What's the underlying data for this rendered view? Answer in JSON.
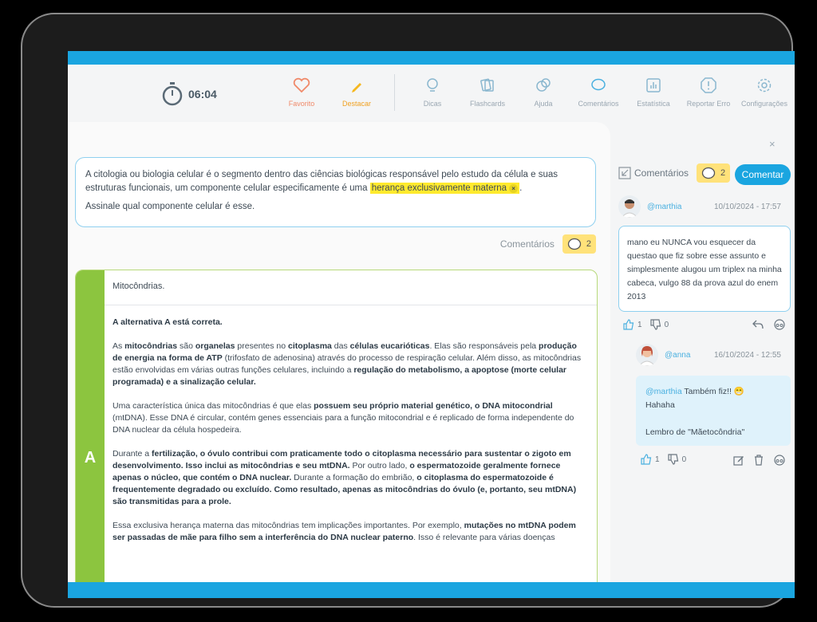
{
  "timer": {
    "value": "06:04"
  },
  "toolbar": {
    "favorite": "Favorito",
    "highlight": "Destacar",
    "tips": "Dicas",
    "flashcards": "Flashcards",
    "help": "Ajuda",
    "comments": "Comentários",
    "stats": "Estatística",
    "report": "Reportar Erro",
    "settings": "Configurações"
  },
  "question": {
    "text_before": "A citologia ou biologia celular é o segmento dentro das ciências biológicas responsável pelo estudo da célula e suas estruturas funcionais, um componente celular especificamente é uma ",
    "highlight": "herança exclusivamente materna",
    "highlight_close": "×",
    "text_after": ".",
    "prompt": "Assinale qual componente celular é esse."
  },
  "question_comments": {
    "label": "Comentários",
    "count": "2"
  },
  "answer": {
    "letter": "A",
    "option": "Mitocôndrias.",
    "correct": "A alternativa A está correta.",
    "p1": {
      "a": "As ",
      "b": "mitocôndrias",
      "c": " são ",
      "d": "organelas",
      "e": " presentes no ",
      "f": "citoplasma",
      "g": " das ",
      "h": "células eucarióticas",
      "i": ". Elas são responsáveis pela ",
      "j": "produção de energia na forma de ATP",
      "k": " (trifosfato de adenosina) através do processo de respiração celular. Além disso, as mitocôndrias estão envolvidas em várias outras funções celulares, incluindo a ",
      "l": "regulação do metabolismo, a apoptose (morte celular programada) e a sinalização celular."
    },
    "p2": {
      "a": "Uma característica única das mitocôndrias é que elas ",
      "b": "possuem seu próprio material genético, o DNA mitocondrial",
      "c": " (mtDNA). Esse DNA é circular, contém genes essenciais para a função mitocondrial e é replicado de forma independente do DNA nuclear da célula hospedeira."
    },
    "p3": {
      "a": "Durante a ",
      "b": "fertilização",
      "c": ", o óvulo contribui com praticamente todo o citoplasma necessário para sustentar o zigoto em desenvolvimento. Isso inclui as mitocôndrias e seu mtDNA.",
      "d": " Por outro lado, ",
      "e": "o espermatozoide geralmente fornece apenas o núcleo, que contém o DNA nuclear.",
      "f": " Durante a formação do embrião, ",
      "g": "o citoplasma do espermatozoide é frequentemente degradado ou excluído. Como resultado, apenas as mitocôndrias do óvulo (e, portanto, seu mtDNA) são transmitidas para a prole."
    },
    "p4": {
      "a": "Essa exclusiva herança materna das mitocôndrias tem implicações importantes. Por exemplo, ",
      "b": "mutações no mtDNA podem ser passadas de mãe para filho sem a interferência do DNA nuclear paterno",
      "c": ". Isso é relevante para várias doenças"
    }
  },
  "side": {
    "close": "×",
    "label": "Comentários",
    "count": "2",
    "button": "Comentar",
    "comment1": {
      "user": "@marthia",
      "date": "10/10/2024 - 17:57",
      "text": "mano eu NUNCA vou esquecer da questao que fiz sobre esse assunto e simplesmente alugou um triplex na minha cabeca, vulgo 88 da prova azul do enem 2013",
      "likes": "1",
      "dislikes": "0"
    },
    "reply1": {
      "user": "@anna",
      "date": "16/10/2024 - 12:55",
      "mention": "@marthia",
      "line1": " Também fiz!! 😁",
      "line2": "Hahaha",
      "line3": "Lembro de \"Mãetocôndria\"",
      "likes": "1",
      "dislikes": "0"
    }
  },
  "colors": {
    "accent": "#1aa5e0",
    "correct": "#8cc53f",
    "highlight": "#ffea2e",
    "badge": "#ffe27a"
  }
}
